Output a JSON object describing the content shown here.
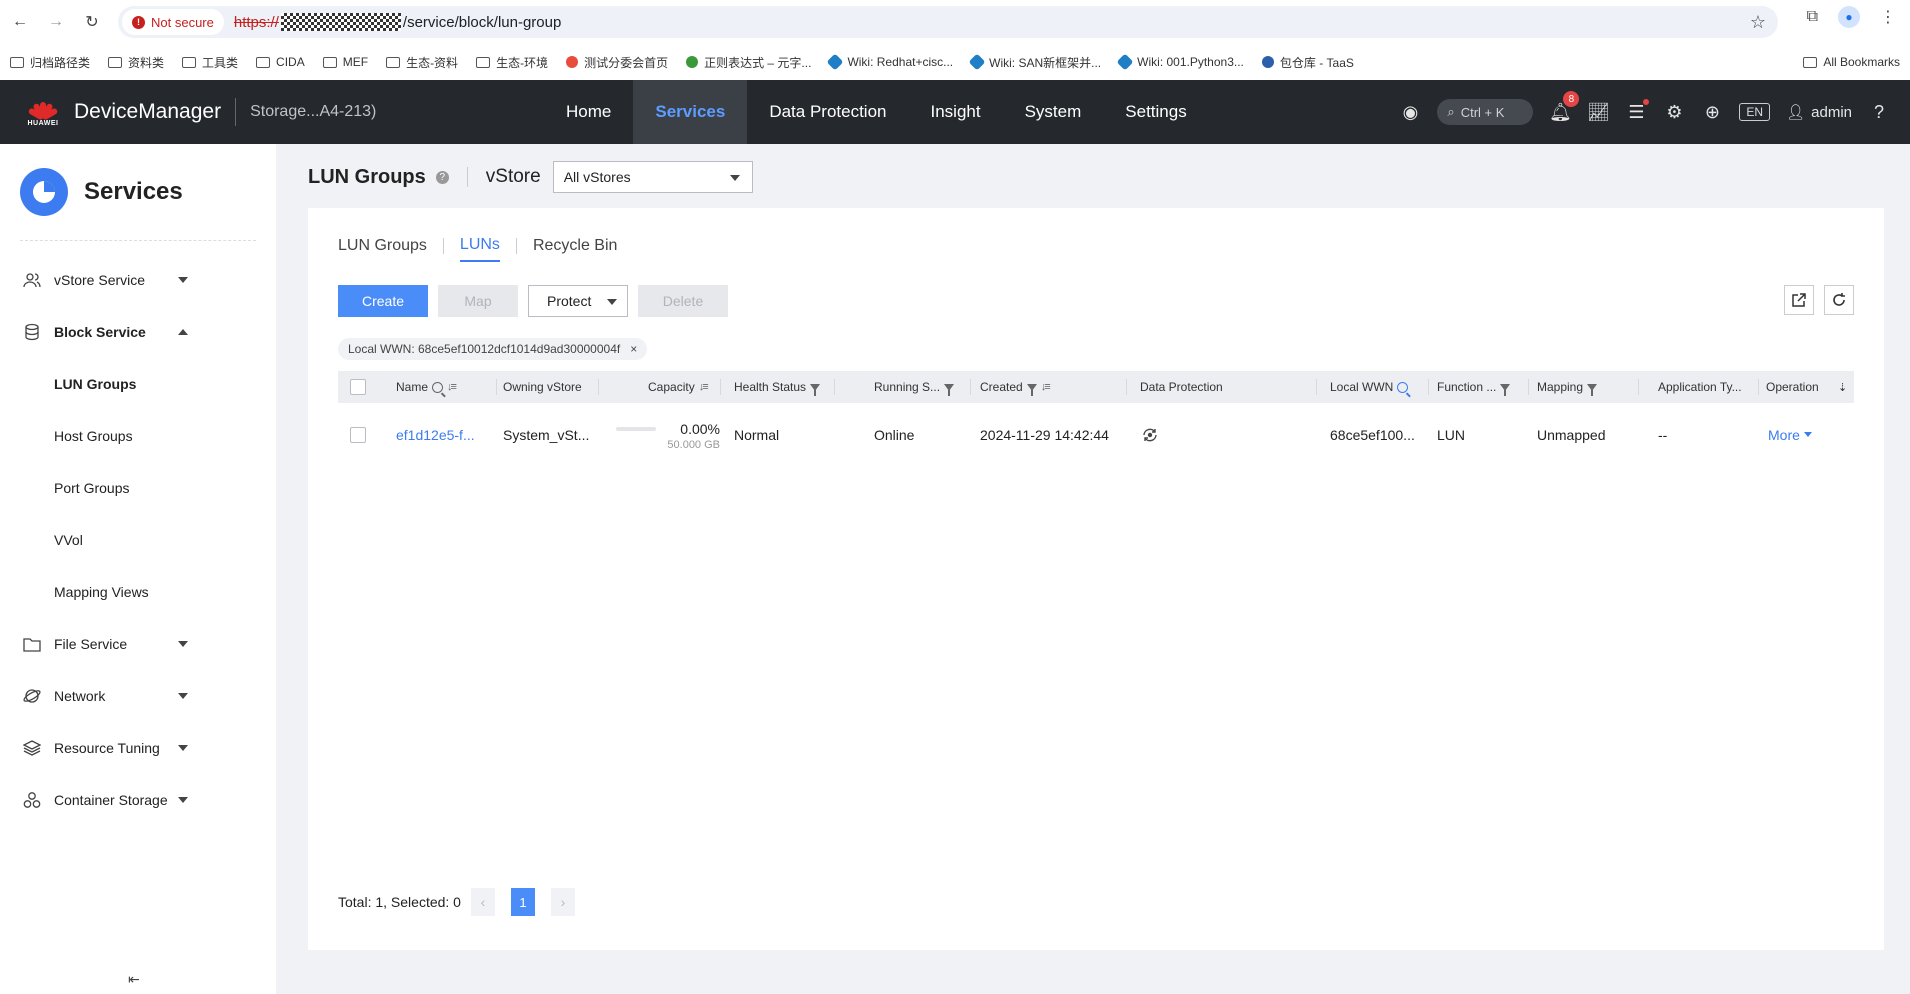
{
  "browser": {
    "security_label": "Not secure",
    "url_scheme": "https://",
    "url_path": "/service/block/lun-group",
    "bookmarks": [
      {
        "label": "归档路径类",
        "type": "folder"
      },
      {
        "label": "资料类",
        "type": "folder"
      },
      {
        "label": "工具类",
        "type": "folder"
      },
      {
        "label": "CIDA",
        "type": "folder"
      },
      {
        "label": "MEF",
        "type": "folder"
      },
      {
        "label": "生态-资料",
        "type": "folder"
      },
      {
        "label": "生态-环境",
        "type": "folder"
      },
      {
        "label": "测试分委会首页",
        "type": "page"
      },
      {
        "label": "正则表达式 – 元字...",
        "type": "page"
      },
      {
        "label": "Wiki: Redhat+cisc...",
        "type": "page"
      },
      {
        "label": "Wiki: SAN新框架并...",
        "type": "page"
      },
      {
        "label": "Wiki: 001.Python3...",
        "type": "page"
      },
      {
        "label": "包仓库 - TaaS",
        "type": "page"
      }
    ],
    "all_bookmarks": "All Bookmarks"
  },
  "header": {
    "brand": "HUAWEI",
    "app_title": "DeviceManager",
    "storage_name": "Storage...A4-213)",
    "nav": [
      "Home",
      "Services",
      "Data Protection",
      "Insight",
      "System",
      "Settings"
    ],
    "active_nav": "Services",
    "search_shortcut": "Ctrl + K",
    "alert_count": "8",
    "language": "EN",
    "user": "admin"
  },
  "sidebar": {
    "title": "Services",
    "items": [
      {
        "label": "vStore Service",
        "icon": "users-icon",
        "expanded": false
      },
      {
        "label": "Block Service",
        "icon": "database-icon",
        "expanded": true
      },
      {
        "label": "File Service",
        "icon": "folder-icon",
        "expanded": false
      },
      {
        "label": "Network",
        "icon": "planet-icon",
        "expanded": false
      },
      {
        "label": "Resource Tuning",
        "icon": "layers-icon",
        "expanded": false
      },
      {
        "label": "Container Storage",
        "icon": "cluster-icon",
        "expanded": false
      }
    ],
    "block_sub": [
      "LUN Groups",
      "Host Groups",
      "Port Groups",
      "VVol",
      "Mapping Views"
    ],
    "active_sub": "LUN Groups"
  },
  "page": {
    "title": "LUN Groups",
    "vstore_label": "vStore",
    "vstore_value": "All vStores",
    "tabs": [
      "LUN Groups",
      "LUNs",
      "Recycle Bin"
    ],
    "active_tab": "LUNs",
    "buttons": {
      "create": "Create",
      "map": "Map",
      "protect": "Protect",
      "delete": "Delete"
    },
    "filter_tag": "Local WWN: 68ce5ef10012dcf1014d9ad30000004f",
    "columns": [
      "Name",
      "Owning vStore",
      "Capacity",
      "Health Status",
      "Running S...",
      "Created",
      "Data Protection",
      "Local WWN",
      "Function ...",
      "Mapping",
      "Application Ty...",
      "Operation"
    ],
    "rows": [
      {
        "name": "ef1d12e5-f...",
        "owning_vstore": "System_vSt...",
        "capacity_pct": "0.00%",
        "capacity_total": "50.000 GB",
        "health": "Normal",
        "running": "Online",
        "created": "2024-11-29 14:42:44",
        "local_wwn": "68ce5ef100...",
        "function": "LUN",
        "mapping": "Unmapped",
        "app_type": "--",
        "operation": "More"
      }
    ],
    "pager": {
      "summary": "Total: 1, Selected: 0",
      "page": "1"
    }
  }
}
